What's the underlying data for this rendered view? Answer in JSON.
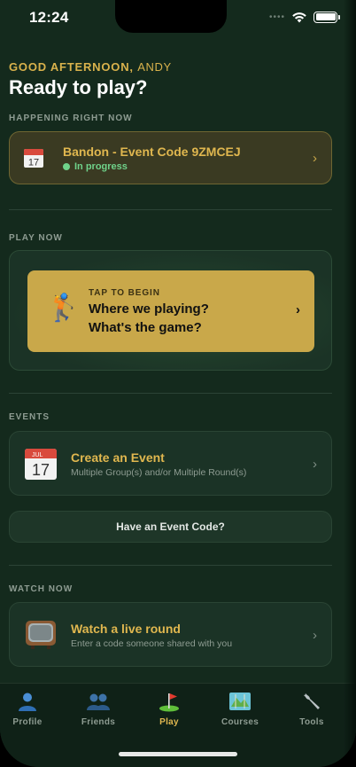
{
  "status_bar": {
    "time": "12:24"
  },
  "greeting": {
    "prefix": "GOOD AFTERNOON,",
    "name": "ANDY",
    "headline": "Ready to play?"
  },
  "happening": {
    "section_label": "HAPPENING RIGHT NOW",
    "calendar_day": "17",
    "title": "Bandon - Event Code 9ZMCEJ",
    "status": "In progress"
  },
  "play": {
    "section_label": "PLAY NOW",
    "tap_label": "TAP TO BEGIN",
    "line1": "Where we playing?",
    "line2": "What's the game?"
  },
  "events": {
    "section_label": "EVENTS",
    "calendar_month": "JUL",
    "calendar_day": "17",
    "create_title": "Create an Event",
    "create_subtitle": "Multiple Group(s) and/or Multiple Round(s)",
    "code_button": "Have an Event Code?"
  },
  "watch": {
    "section_label": "WATCH NOW",
    "title": "Watch a live round",
    "subtitle": "Enter a code someone shared with you"
  },
  "tabs": [
    {
      "label": "Profile",
      "icon": "person-icon",
      "active": false
    },
    {
      "label": "Friends",
      "icon": "people-icon",
      "active": false
    },
    {
      "label": "Play",
      "icon": "golf-flag-icon",
      "active": true
    },
    {
      "label": "Courses",
      "icon": "map-icon",
      "active": false
    },
    {
      "label": "Tools",
      "icon": "wrench-icon",
      "active": false
    }
  ],
  "colors": {
    "accent": "#e0b74f",
    "play_button": "#c9a84a",
    "live_green": "#6fd28a",
    "background": "#142a1d"
  }
}
